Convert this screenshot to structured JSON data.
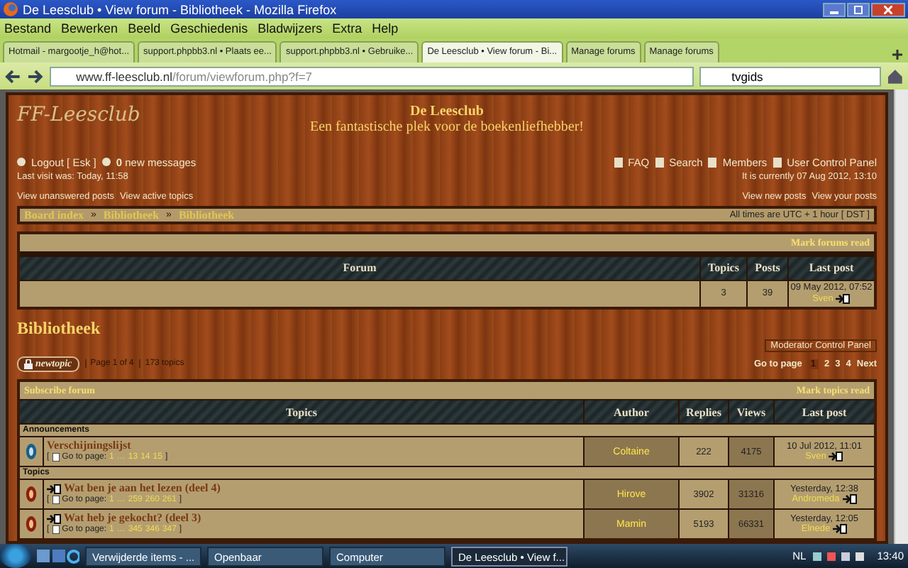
{
  "window": {
    "title": "De Leesclub • View forum - Bibliotheek - Mozilla Firefox"
  },
  "menu": [
    "Bestand",
    "Bewerken",
    "Beeld",
    "Geschiedenis",
    "Bladwijzers",
    "Extra",
    "Help"
  ],
  "tabs": [
    {
      "label": "Hotmail - margootje_h@hot...",
      "selected": false
    },
    {
      "label": "support.phpbb3.nl • Plaats ee...",
      "selected": false
    },
    {
      "label": "support.phpbb3.nl • Gebruike...",
      "selected": false
    },
    {
      "label": "De Leesclub • View forum - Bi...",
      "selected": true
    },
    {
      "label": "Manage forums",
      "selected": false
    },
    {
      "label": "Manage forums",
      "selected": false
    }
  ],
  "address": {
    "host": "www.ff-leesclub.nl",
    "path": "/forum/viewforum.php?f=7"
  },
  "search": {
    "value": "tvgids"
  },
  "forum": {
    "logo": "FF-Leesclub",
    "site_title": "De Leesclub",
    "site_description": "Een fantastische plek voor de boekenliefhebber!",
    "user_links": [
      "Logout [ Esk ]",
      "**0** new messages"
    ],
    "nav_links": [
      "FAQ",
      "Search",
      "Members",
      "User Control Panel"
    ],
    "last_visit": "Last visit was: Today, 11:58",
    "current_time": "It is currently 07 Aug 2012, 13:10",
    "left_links": [
      "View unanswered posts",
      "View active topics"
    ],
    "right_links": [
      "View new posts",
      "View your posts"
    ],
    "breadcrumbs": [
      "Board index",
      "Bibliotheek",
      "Bibliotheek"
    ],
    "separator": "»",
    "timezone": "All times are UTC + 1 hour [ DST ]",
    "mark_forums_read": "Mark forums read",
    "forum_table": {
      "columns": [
        "Forum",
        "Topics",
        "Posts",
        "Last post"
      ],
      "rows": [
        {
          "topics": "3",
          "posts": "39",
          "last_post_date": "09 May 2012, 07:52",
          "last_post_author": "Sven"
        }
      ]
    },
    "heading": "Bibliotheek",
    "moderator_panel": "Moderator Control Panel",
    "new_topic": "newtopic",
    "page_info": "Page 1 of 4",
    "topic_count": "173 topics",
    "go_to_page": "Go to page",
    "pages": [
      {
        "label": "1",
        "selected": true
      },
      {
        "label": "2",
        "selected": false
      },
      {
        "label": "3",
        "selected": false
      },
      {
        "label": "4",
        "selected": false
      }
    ],
    "next": "Next",
    "subscribe": "Subscribe forum",
    "mark_topics_read": "Mark topics read",
    "topics_table": {
      "columns": [
        "Topics",
        "Author",
        "Replies",
        "Views",
        "Last post"
      ],
      "sections": [
        {
          "title": "Announcements",
          "topics": [
            {
              "kind": "announcement",
              "new_posts": false,
              "title": "Verschijningslijst",
              "go_to": "Go to page:",
              "pages": [
                "1",
                "…",
                "13",
                "14",
                "15"
              ],
              "open": "[",
              "close": "]",
              "author": "Coltaine",
              "replies": "222",
              "views": "4175",
              "last_post_date": "10 Jul 2012, 11:01",
              "last_post_author": "Sven"
            }
          ]
        },
        {
          "title": "Topics",
          "topics": [
            {
              "kind": "topic",
              "new_posts": true,
              "title": "Wat ben je aan het lezen (deel 4)",
              "go_to": "Go to page:",
              "pages": [
                "1",
                "…",
                "259",
                "260",
                "261"
              ],
              "open": "[",
              "close": "]",
              "author": "Hirove",
              "replies": "3902",
              "views": "31316",
              "last_post_date": "Yesterday, 12:38",
              "last_post_author": "Andromeda"
            },
            {
              "kind": "topic",
              "new_posts": true,
              "title": "Wat heb je gekocht? (deel 3)",
              "go_to": "Go to page:",
              "pages": [
                "1",
                "…",
                "345",
                "346",
                "347"
              ],
              "open": "[",
              "close": "]",
              "author": "Mamin",
              "replies": "5193",
              "views": "66331",
              "last_post_date": "Yesterday, 12:05",
              "last_post_author": "Elnede"
            }
          ]
        }
      ]
    }
  },
  "taskbar": {
    "items": [
      {
        "label": "Verwijderde items - ...",
        "selected": false
      },
      {
        "label": "Openbaar",
        "selected": false
      },
      {
        "label": "Computer",
        "selected": false
      },
      {
        "label": "De Leesclub • View f...",
        "selected": true
      }
    ],
    "language": "NL",
    "clock": "13:40"
  }
}
